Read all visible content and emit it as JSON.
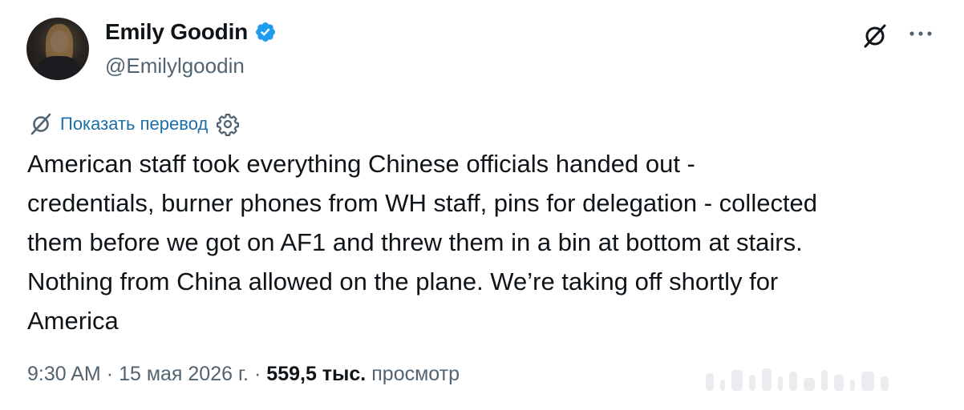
{
  "author": {
    "display_name": "Emily Goodin",
    "handle": "@Emilylgoodin",
    "verified": true
  },
  "header_actions": {
    "grok_icon": "grok-slash-icon",
    "more_icon": "ellipsis-icon"
  },
  "translate": {
    "label": "Показать перевод",
    "icon": "grok-slash-icon",
    "settings_icon": "gear-icon"
  },
  "tweet": {
    "text": "American staff took everything Chinese officials handed out -\ncredentials, burner phones from WH staff, pins for delegation - collected\nthem before we got on AF1 and threw them in a bin at bottom at stairs.\nNothing from China allowed on the plane. We’re taking off shortly for\nAmerica"
  },
  "meta": {
    "time": "9:30 AM",
    "separator": "·",
    "date": "15 мая 2026 г.",
    "views_count": "559,5 тыс.",
    "views_label": "просмотр"
  },
  "colors": {
    "text_primary": "#0f1419",
    "text_secondary": "#536471",
    "link": "#1d6fa5",
    "verified_badge": "#1d9bf0"
  }
}
